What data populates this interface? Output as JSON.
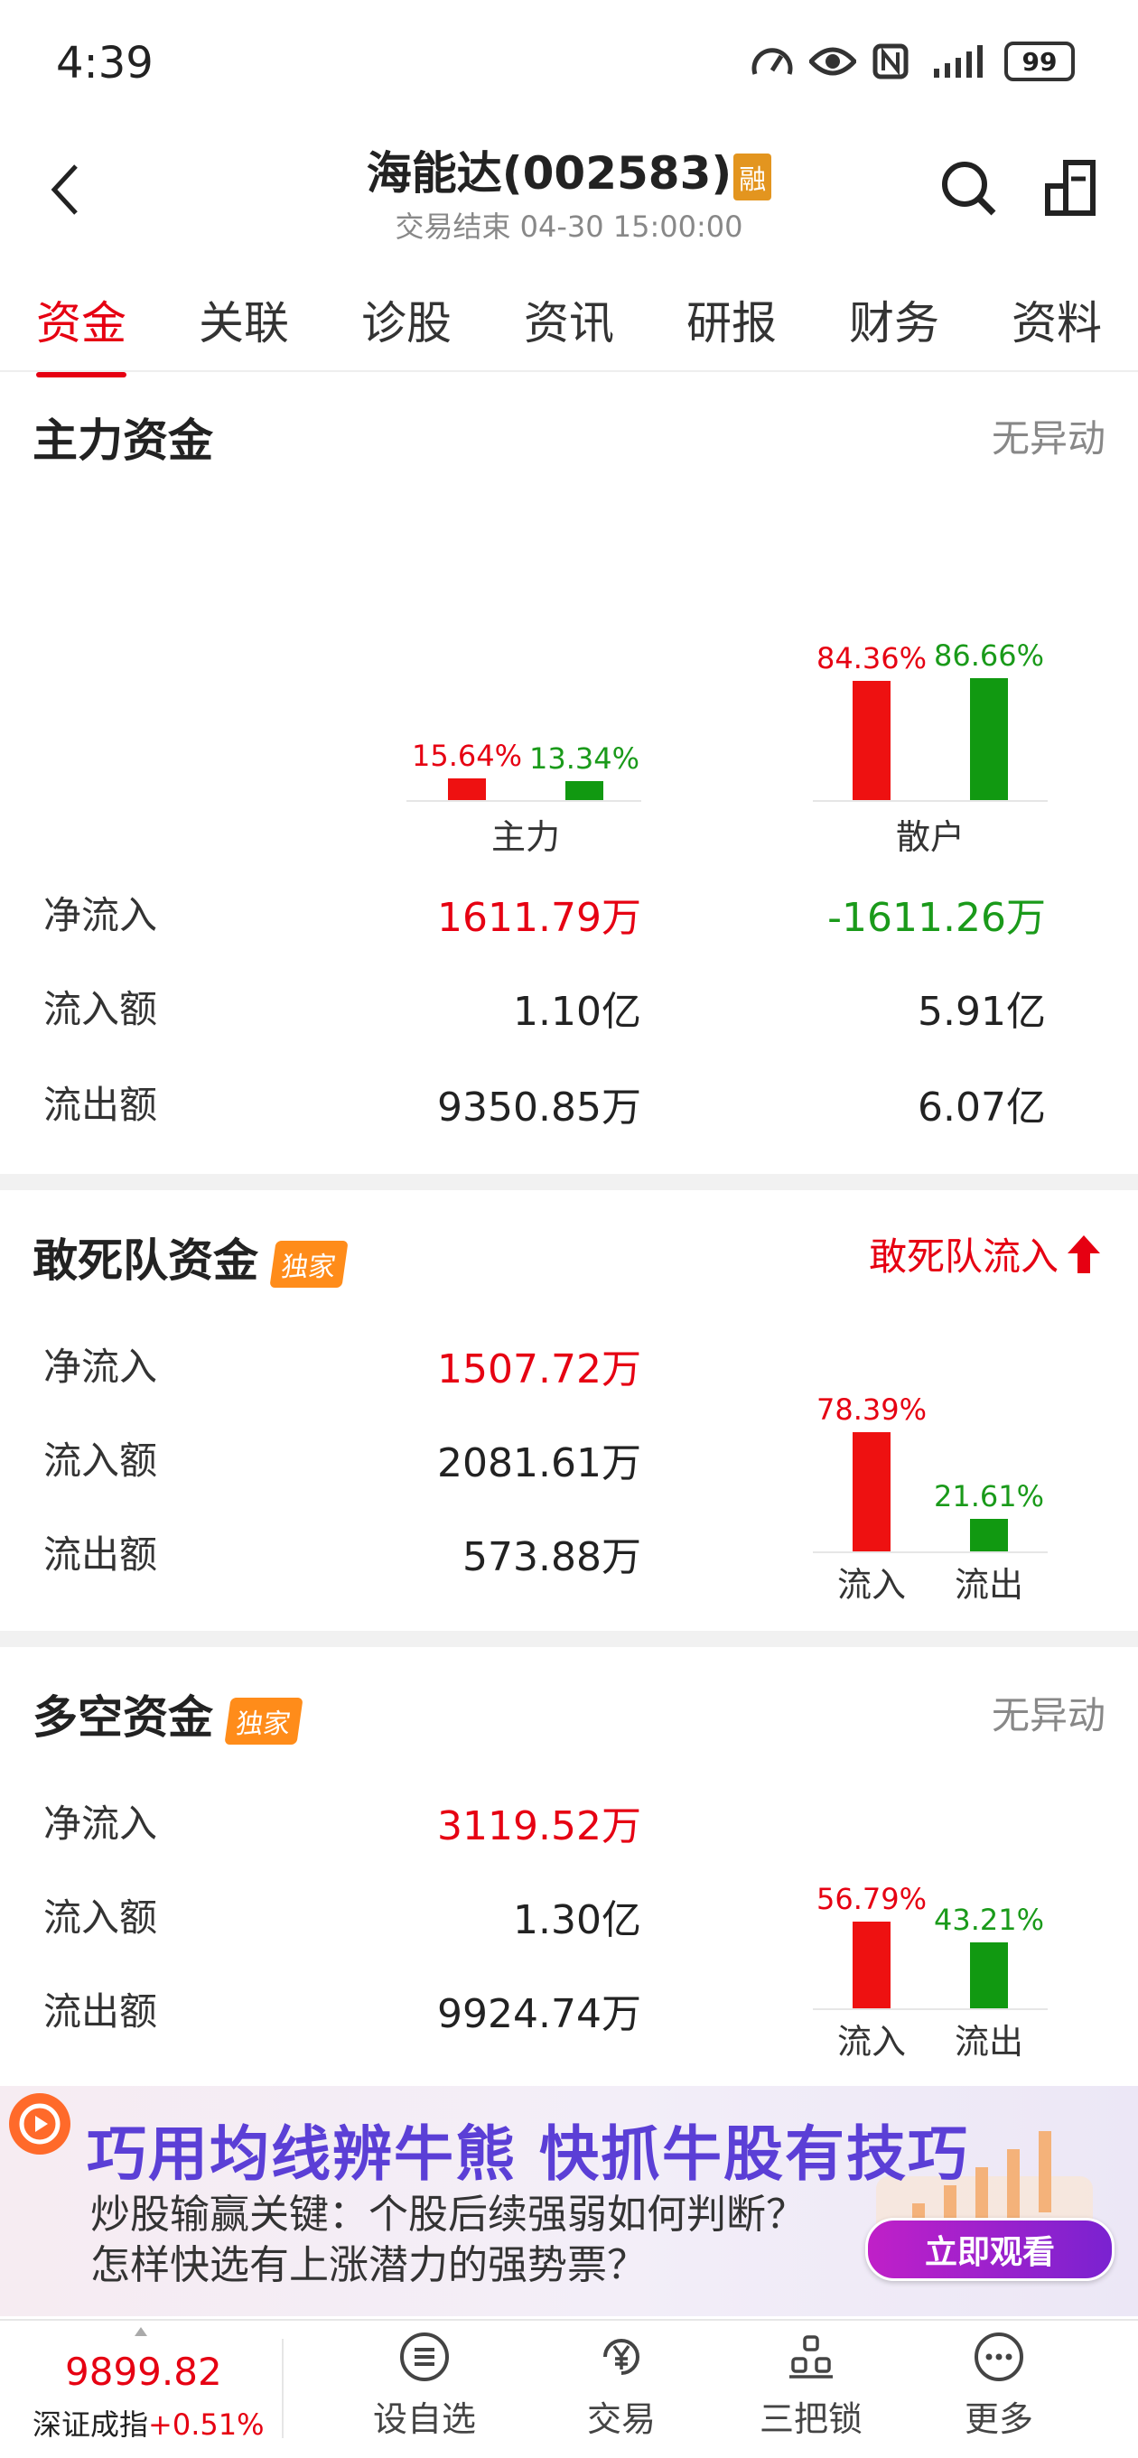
{
  "status": {
    "time": "4:39",
    "battery": "99"
  },
  "header": {
    "title": "海能达(002583)",
    "rong_badge": "融",
    "subtitle": "交易结束 04-30 15:00:00"
  },
  "tabs": [
    "资金",
    "关联",
    "诊股",
    "资讯",
    "研报",
    "财务",
    "资料"
  ],
  "main_force": {
    "title": "主力资金",
    "status": "无异动",
    "chart": {
      "groups": [
        {
          "label": "主力",
          "inflow_pct": "15.64%",
          "outflow_pct": "13.34%",
          "inflow": 15.64,
          "outflow": 13.34
        },
        {
          "label": "散户",
          "inflow_pct": "84.36%",
          "outflow_pct": "86.66%",
          "inflow": 84.36,
          "outflow": 86.66
        }
      ]
    },
    "rows": [
      {
        "label": "净流入",
        "main": "1611.79万",
        "retail": "-1611.26万"
      },
      {
        "label": "流入额",
        "main": "1.10亿",
        "retail": "5.91亿"
      },
      {
        "label": "流出额",
        "main": "9350.85万",
        "retail": "6.07亿"
      }
    ]
  },
  "dare_die": {
    "title": "敢死队资金",
    "badge": "独家",
    "status": "敢死队流入",
    "rows": [
      {
        "label": "净流入",
        "value": "1507.72万"
      },
      {
        "label": "流入额",
        "value": "2081.61万"
      },
      {
        "label": "流出额",
        "value": "573.88万"
      }
    ],
    "chart": {
      "inflow_pct": "78.39%",
      "outflow_pct": "21.61%",
      "inflow": 78.39,
      "outflow": 21.61,
      "inflow_label": "流入",
      "outflow_label": "流出"
    }
  },
  "long_short": {
    "title": "多空资金",
    "badge": "独家",
    "status": "无异动",
    "rows": [
      {
        "label": "净流入",
        "value": "3119.52万"
      },
      {
        "label": "流入额",
        "value": "1.30亿"
      },
      {
        "label": "流出额",
        "value": "9924.74万"
      }
    ],
    "chart": {
      "inflow_pct": "56.79%",
      "outflow_pct": "43.21%",
      "inflow": 56.79,
      "outflow": 43.21,
      "inflow_label": "流入",
      "outflow_label": "流出"
    }
  },
  "banner": {
    "title": "巧用均线辨牛熊 快抓牛股有技巧",
    "line1": "炒股输赢关键：个股后续强弱如何判断？",
    "line2": "怎样快选有上涨潜力的强势票？",
    "button": "立即观看"
  },
  "bottom": {
    "index_value": "9899.82",
    "index_name": "深证成指",
    "index_change": "+0.51%",
    "nav": [
      "设自选",
      "交易",
      "三把锁",
      "更多"
    ]
  },
  "colors": {
    "accent": "#e60012",
    "green": "#1a9a1a",
    "badge": "#ff8c1a"
  }
}
